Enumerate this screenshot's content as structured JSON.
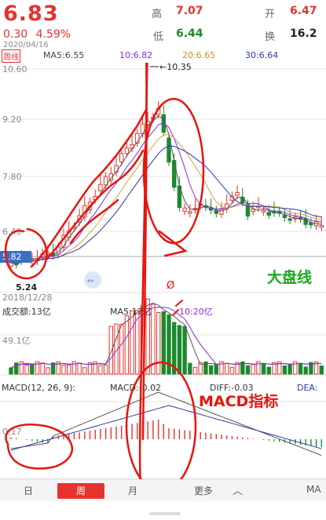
{
  "quote": {
    "price": "6.83",
    "change": "0.30",
    "change_pct": "4.59%",
    "date": "2020/04/16",
    "high_label": "高",
    "high_value": "7.07",
    "low_label": "低",
    "low_value": "6.44",
    "open_label": "开",
    "open_value": "6.47",
    "turnover_label": "换",
    "turnover_value": "16.2"
  },
  "ma_bar": {
    "period": "周线",
    "ma5": "MA5:6.55",
    "ma10": "10:6.82",
    "ma20": "20:6.65",
    "ma30": "30:6.64"
  },
  "price_axis": [
    "10.60",
    "9.20",
    "7.80",
    "6.40"
  ],
  "price_marks": {
    "max_label": "10.35",
    "min_label": "5.24",
    "current_tag": "5.82",
    "start_date": "2018/12/28"
  },
  "volume": {
    "title": "成交额:13亿",
    "ma5": "MA5:12亿",
    "ma10": "10:20亿",
    "axis": "49.1亿"
  },
  "macd": {
    "title": "MACD(12, 26, 9):",
    "macd_value": "MACD:-0.02",
    "diff_value": "DIFF:-0.03",
    "dea_value": "DEA:",
    "axis": "0.17"
  },
  "annotations": {
    "market_line": "大盘线",
    "macd_indicator": "MACD指标",
    "mark_glyph": "Ø"
  },
  "tabs": {
    "day": "日",
    "week": "周",
    "month": "月",
    "more": "更多",
    "up_arrow": "︿",
    "right_label": "MA"
  },
  "colors": {
    "up": "#e8322e",
    "down": "#1b8a2e",
    "ma5": "#555555",
    "ma10": "#8a2be2",
    "ma20": "#d9a03a",
    "ma30": "#2b3aa8",
    "annotation": "#e8140c",
    "market_text": "#19a81e"
  }
}
